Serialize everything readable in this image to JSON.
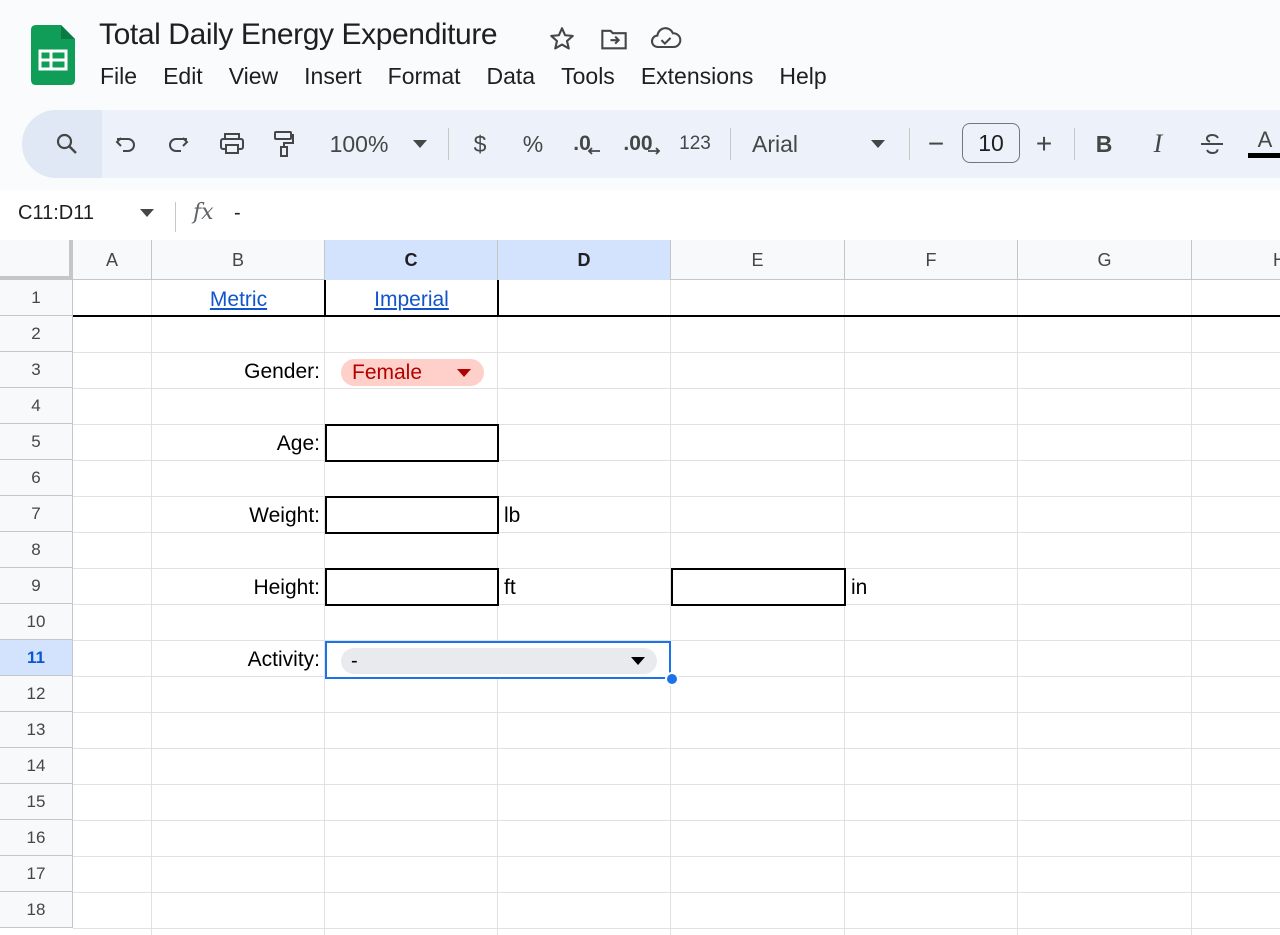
{
  "app": {
    "title": "Total Daily Energy Expenditure",
    "brand_color": "#0f9d58"
  },
  "menu": [
    "File",
    "Edit",
    "View",
    "Insert",
    "Format",
    "Data",
    "Tools",
    "Extensions",
    "Help"
  ],
  "toolbar": {
    "zoom": "100%",
    "currency": "$",
    "percent": "%",
    "decrease_decimal": ".0",
    "increase_decimal": ".00",
    "number_format": "123",
    "font": "Arial",
    "font_size": "10",
    "minus": "−",
    "plus": "+",
    "bold": "B",
    "italic": "I",
    "text_color": "A"
  },
  "formula_bar": {
    "name_box": "C11:D11",
    "fx": "fx",
    "value": "-"
  },
  "columns": [
    "A",
    "B",
    "C",
    "D",
    "E",
    "F",
    "G",
    "H"
  ],
  "rows": [
    "1",
    "2",
    "3",
    "4",
    "5",
    "6",
    "7",
    "8",
    "9",
    "10",
    "11",
    "12",
    "13",
    "14",
    "15",
    "16",
    "17",
    "18"
  ],
  "sheet": {
    "metric_link": "Metric",
    "imperial_link": "Imperial",
    "gender_label": "Gender:",
    "gender_value": "Female",
    "age_label": "Age:",
    "weight_label": "Weight:",
    "weight_unit": "lb",
    "height_label": "Height:",
    "height_unit_ft": "ft",
    "height_unit_in": "in",
    "activity_label": "Activity:",
    "activity_value": "-"
  }
}
